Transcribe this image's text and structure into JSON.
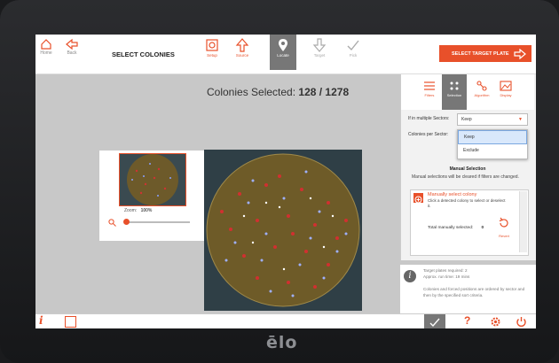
{
  "header": {
    "home_label": "Home",
    "back_label": "Back",
    "title": "SELECT COLONIES",
    "steps": [
      {
        "label": "Setup",
        "icon": "gear-icon"
      },
      {
        "label": "Source",
        "icon": "arrow-up-icon"
      },
      {
        "label": "Locate",
        "icon": "location-pin-icon"
      },
      {
        "label": "Target",
        "icon": "arrow-down-icon"
      },
      {
        "label": "Pick",
        "icon": "check-icon"
      }
    ],
    "target_button": "SELECT TARGET PLATE"
  },
  "main": {
    "colonies_label": "Colonies Selected: ",
    "colonies_value": "128 / 1278",
    "zoom_label": "Zoom:",
    "zoom_value": "100%"
  },
  "panel": {
    "tabs": [
      {
        "label": "Filters",
        "icon": "filters-icon"
      },
      {
        "label": "Selection",
        "icon": "selection-icon"
      },
      {
        "label": "Algorithm",
        "icon": "algorithm-icon"
      },
      {
        "label": "Display",
        "icon": "display-icon"
      }
    ],
    "multi_sector_label": "If in multiple Sectors:",
    "multi_sector_value": "Keep",
    "colonies_per_sector_label": "Colonies per Sector:",
    "dropdown_options": [
      "Keep",
      "Exclude"
    ],
    "manual_title": "Manual Selection",
    "manual_note": "Manual selections will be cleared if filters are changed.",
    "manual_item_title": "Manually select colony",
    "manual_item_desc": "Click a detected colony to select or deselect it.",
    "total_label": "Total manually selected:",
    "total_value": "0",
    "revert_label": "Revert"
  },
  "info": {
    "line1": "Target plates required: 2",
    "line2": "Approx. run time: 19 mins",
    "line3": "Colonies and forced positions are ordered by sector and then by the specified sort criteria."
  },
  "footer": {
    "help_label": "?"
  },
  "device": {
    "brand": "ēlo"
  },
  "colors": {
    "accent": "#e8502a"
  }
}
